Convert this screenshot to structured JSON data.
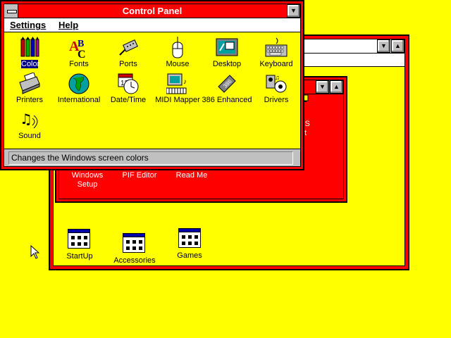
{
  "control_panel": {
    "title": "Control Panel",
    "menu": [
      "Settings",
      "Help"
    ],
    "items": [
      {
        "label": "Color",
        "icon": "color-icon"
      },
      {
        "label": "Fonts",
        "icon": "fonts-icon"
      },
      {
        "label": "Ports",
        "icon": "ports-icon"
      },
      {
        "label": "Mouse",
        "icon": "mouse-icon"
      },
      {
        "label": "Desktop",
        "icon": "desktop-icon"
      },
      {
        "label": "Keyboard",
        "icon": "keyboard-icon"
      },
      {
        "label": "Printers",
        "icon": "printer-icon"
      },
      {
        "label": "International",
        "icon": "globe-icon"
      },
      {
        "label": "Date/Time",
        "icon": "clock-icon"
      },
      {
        "label": "MIDI Mapper",
        "icon": "midi-icon"
      },
      {
        "label": "386 Enhanced",
        "icon": "chip-icon"
      },
      {
        "label": "Drivers",
        "icon": "drivers-icon"
      },
      {
        "label": "Sound",
        "icon": "sound-icon"
      }
    ],
    "status": "Changes the Windows screen colors"
  },
  "main_group": {
    "items": [
      {
        "label": "Windows\nSetup"
      },
      {
        "label": "PIF Editor"
      },
      {
        "label": "Read Me"
      },
      {
        "label": "OS"
      },
      {
        "label": "ot"
      }
    ]
  },
  "program_manager": {
    "groups": [
      {
        "label": "StartUp"
      },
      {
        "label": "Accessories"
      },
      {
        "label": "Games"
      }
    ]
  },
  "colors": {
    "desktop": "#ffff00",
    "window_frame": "#ff0000",
    "title_active": "#ff0000"
  }
}
